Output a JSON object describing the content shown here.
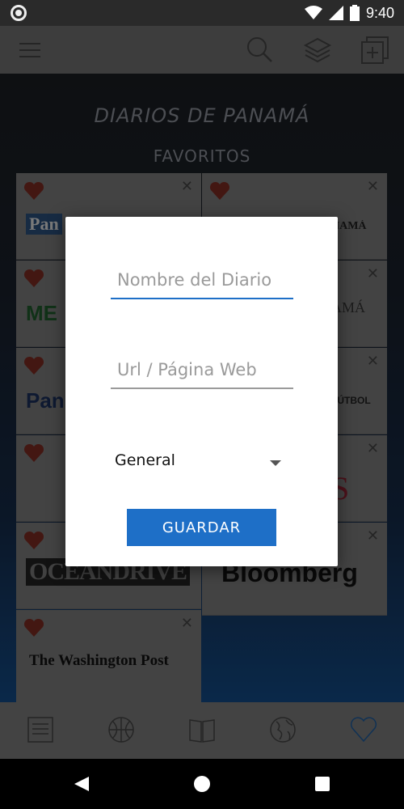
{
  "status_bar": {
    "time": "9:40"
  },
  "toolbar": {
    "icons": [
      "menu-icon",
      "search-icon",
      "layers-icon",
      "add-box-icon"
    ]
  },
  "main": {
    "title": "DIARIOS DE PANAMÁ",
    "subtitle": "FAVORITOS",
    "cards_left": [
      {
        "logo": "Pan"
      },
      {
        "logo": "ME"
      },
      {
        "logo": "Pan"
      },
      {
        "logo": ""
      },
      {
        "logo": "OCEANDRIVE"
      },
      {
        "logo": "The Washington Post"
      }
    ],
    "cards_right": [
      {
        "logo": "NAMÁ"
      },
      {
        "logo": "AMÁ"
      },
      {
        "logo": "FÚTBOL"
      },
      {
        "logo": "S"
      },
      {
        "logo": "Bloomberg"
      }
    ]
  },
  "dialog": {
    "name_placeholder": "Nombre del Diario",
    "url_placeholder": "Url / Página Web",
    "category_value": "General",
    "save_label": "GUARDAR"
  },
  "bottom_nav": {
    "items": [
      "news-icon",
      "basketball-icon",
      "book-icon",
      "globe-icon",
      "heart-icon"
    ],
    "active_color": "#1e6fc7"
  },
  "colors": {
    "accent": "#1e6fc7",
    "heart": "#c0392b"
  }
}
